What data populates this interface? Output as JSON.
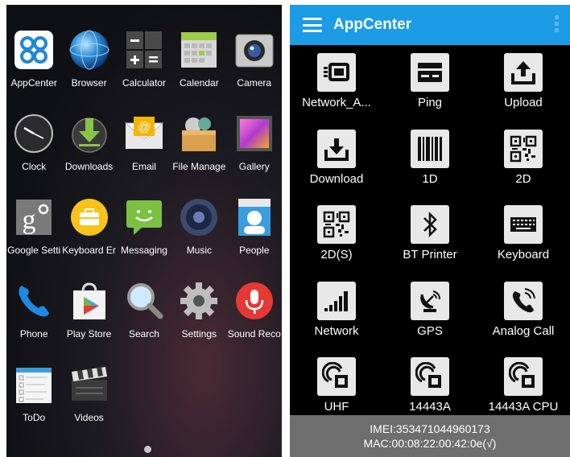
{
  "launcher": {
    "apps": [
      {
        "label": "AppCenter",
        "icon": "appcenter-icon"
      },
      {
        "label": "Browser",
        "icon": "globe-icon"
      },
      {
        "label": "Calculator",
        "icon": "calculator-icon"
      },
      {
        "label": "Calendar",
        "icon": "calendar-icon"
      },
      {
        "label": "Camera",
        "icon": "camera-icon"
      },
      {
        "label": "Clock",
        "icon": "clock-icon"
      },
      {
        "label": "Downloads",
        "icon": "download-arrow-icon"
      },
      {
        "label": "Email",
        "icon": "envelope-icon"
      },
      {
        "label": "File Manage",
        "icon": "folder-icon"
      },
      {
        "label": "Gallery",
        "icon": "gallery-icon"
      },
      {
        "label": "Google Setti",
        "icon": "google-settings-icon"
      },
      {
        "label": "Keyboard Er",
        "icon": "keyboard-briefcase-icon"
      },
      {
        "label": "Messaging",
        "icon": "speech-bubble-icon"
      },
      {
        "label": "Music",
        "icon": "speaker-icon"
      },
      {
        "label": "People",
        "icon": "contact-card-icon"
      },
      {
        "label": "Phone",
        "icon": "phone-handset-icon"
      },
      {
        "label": "Play Store",
        "icon": "play-store-bag-icon"
      },
      {
        "label": "Search",
        "icon": "magnifier-icon"
      },
      {
        "label": "Settings",
        "icon": "gear-icon"
      },
      {
        "label": "Sound Reco",
        "icon": "microphone-icon"
      },
      {
        "label": "ToDo",
        "icon": "checklist-icon"
      },
      {
        "label": "Videos",
        "icon": "clapperboard-icon"
      }
    ]
  },
  "appcenter": {
    "title": "AppCenter",
    "accent": "#1c9be6",
    "items": [
      {
        "label": "Network_A...",
        "icon": "network-adapter-icon"
      },
      {
        "label": "Ping",
        "icon": "ping-icon"
      },
      {
        "label": "Upload",
        "icon": "upload-icon"
      },
      {
        "label": "Download",
        "icon": "download-icon"
      },
      {
        "label": "1D",
        "icon": "barcode-icon"
      },
      {
        "label": "2D",
        "icon": "qr-code-icon"
      },
      {
        "label": "2D(S)",
        "icon": "qr-code-icon"
      },
      {
        "label": "BT Printer",
        "icon": "bluetooth-icon"
      },
      {
        "label": "Keyboard",
        "icon": "keyboard-icon"
      },
      {
        "label": "Network",
        "icon": "signal-bars-icon"
      },
      {
        "label": "GPS",
        "icon": "satellite-dish-icon"
      },
      {
        "label": "Analog Call",
        "icon": "phone-ringing-icon"
      },
      {
        "label": "UHF",
        "icon": "rfid-card-icon"
      },
      {
        "label": "14443A",
        "icon": "rfid-card-icon"
      },
      {
        "label": "14443A CPU",
        "icon": "rfid-card-icon"
      }
    ],
    "footer": {
      "imei": "IMEI:353471044960173",
      "mac": "MAC:00:08:22:00:42:0e(√)"
    }
  }
}
